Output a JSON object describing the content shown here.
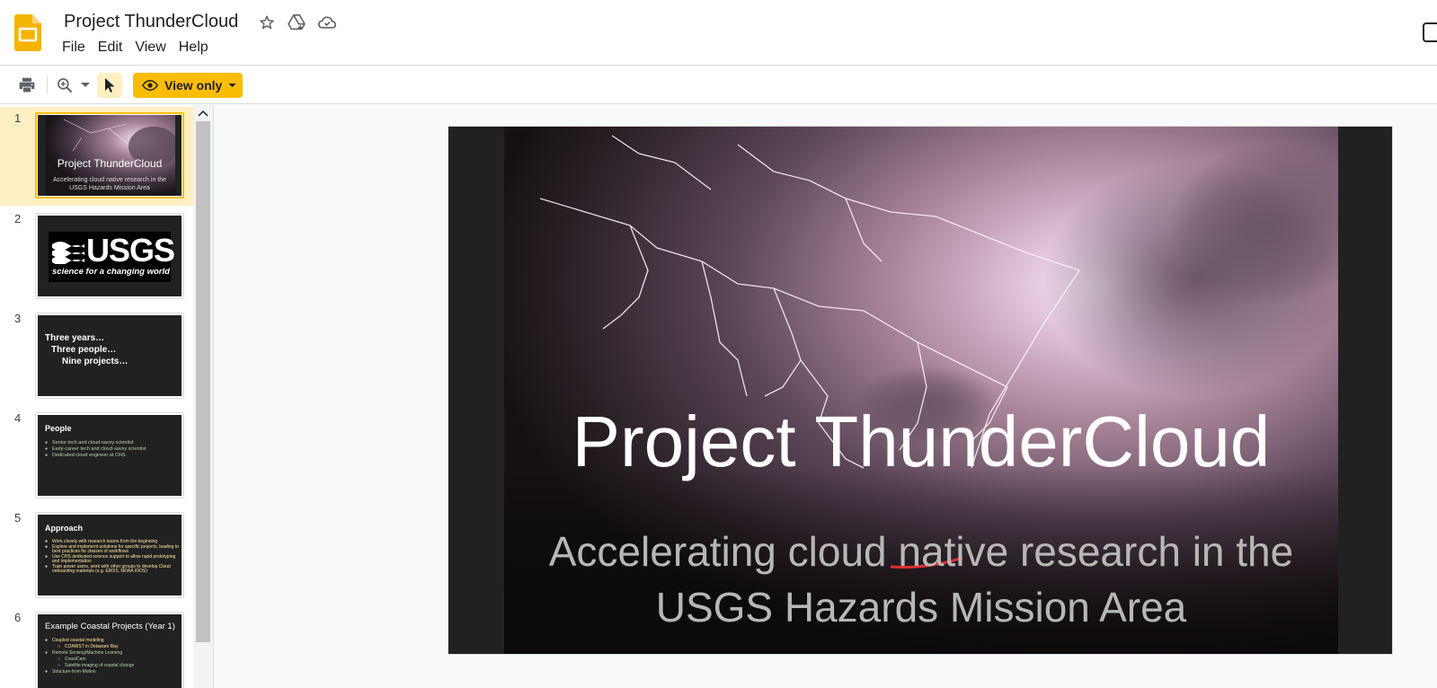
{
  "doc": {
    "title": "Project ThunderCloud"
  },
  "menu": [
    "File",
    "Edit",
    "View",
    "Help"
  ],
  "toolbar": {
    "view_only_label": "View only"
  },
  "filmstrip": {
    "slides": [
      {
        "number": "1",
        "title": "Project ThunderCloud",
        "subtitle_line1": "Accelerating cloud native research in the",
        "subtitle_line2": "USGS Hazards Mission Area"
      },
      {
        "number": "2",
        "logo_text": "USGS",
        "tagline": "science for a changing world"
      },
      {
        "number": "3",
        "lines": [
          "Three years…",
          "Three people…",
          "Nine projects…"
        ]
      },
      {
        "number": "4",
        "title": "People",
        "bullets": [
          "Senior tech and cloud-savvy scientist",
          "Early-career tech and cloud-savvy scientist",
          "Dedicated cloud engineer at CHS"
        ]
      },
      {
        "number": "5",
        "title": "Approach",
        "bullets": [
          "Work closely with research teams from the beginning",
          "Explore and implement solutions for specific projects, leading to  best practices for classes of workflows",
          "Use CHS dedicated science support to allow rapid prototyping and implementation",
          "Train power users, work with other groups to develop Cloud onboarding materials (e.g. EROS, NOAA IOOS)"
        ]
      },
      {
        "number": "6",
        "title": "Example Coastal Projects (Year 1)",
        "bullets": [
          "Coupled coastal modeling",
          "COAWST in Delaware Bay",
          "Remote Sensing/Machine Learning",
          "CoastCam",
          "Satellite imaging of coastal change",
          "Structure-from-Motion"
        ]
      }
    ]
  },
  "slide": {
    "title": "Project ThunderCloud",
    "subtitle_line1": "Accelerating cloud native research in the",
    "subtitle_line2": "USGS Hazards Mission Area"
  },
  "colors": {
    "accent": "#fbbc04",
    "slides_logo": "#f4b400",
    "slide_bg": "#212121",
    "thumb_bullet_green": "#b6d7a8",
    "thumb_bullet_yellow": "#ffe599"
  },
  "icons": {
    "star": "star-icon",
    "drive_move": "move-to-drive-icon",
    "cloud_status": "cloud-status-icon",
    "print": "print-icon",
    "zoom": "zoom-icon",
    "select": "cursor-icon",
    "eye": "eye-icon"
  }
}
